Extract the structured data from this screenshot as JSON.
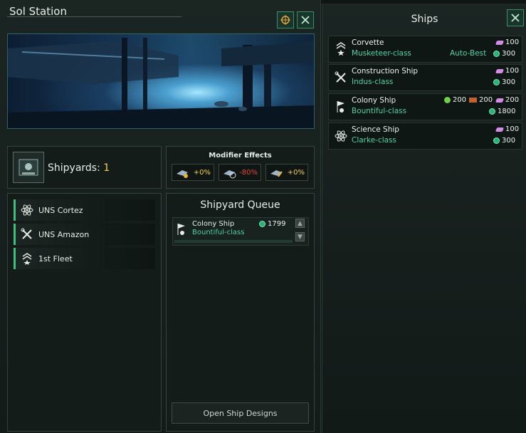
{
  "station": {
    "title": "Sol Station",
    "shipyards_label": "Shipyards:",
    "shipyards_count": "1",
    "modifier_title": "Modifier Effects",
    "modifiers": [
      {
        "value": "+0%",
        "color": "#f2d24b"
      },
      {
        "value": "-80%",
        "color": "#e2453a"
      },
      {
        "value": "+0%",
        "color": "#f2d24b"
      }
    ],
    "fleets": [
      {
        "name": "UNS Cortez",
        "icon": "atom-icon"
      },
      {
        "name": "UNS Amazon",
        "icon": "wrench-icon"
      },
      {
        "name": "1st Fleet",
        "icon": "chevron-star-icon"
      }
    ],
    "queue": {
      "title": "Shipyard Queue",
      "item_name": "Colony Ship",
      "item_class": "Bountiful-class",
      "item_cost": "1799"
    },
    "open_designs_label": "Open Ship Designs"
  },
  "ships": {
    "title": "Ships",
    "items": [
      {
        "name": "Corvette",
        "class": "Musketeer-class",
        "extra": "Auto-Best",
        "alloys": "100",
        "cost": "300",
        "icon": "chevron-star-icon"
      },
      {
        "name": "Construction Ship",
        "class": "Indus-class",
        "alloys": "100",
        "cost": "300",
        "icon": "wrench-icon"
      },
      {
        "name": "Colony Ship",
        "class": "Bountiful-class",
        "food": "200",
        "consumer_goods": "200",
        "alloys": "200",
        "cost": "1800",
        "icon": "colony-icon"
      },
      {
        "name": "Science Ship",
        "class": "Clarke-class",
        "alloys": "100",
        "cost": "300",
        "icon": "atom-icon"
      }
    ]
  },
  "colors": {
    "accent": "#4fd1a2",
    "yellow": "#f2d24b",
    "fleet_bar": "#3cc17b"
  }
}
